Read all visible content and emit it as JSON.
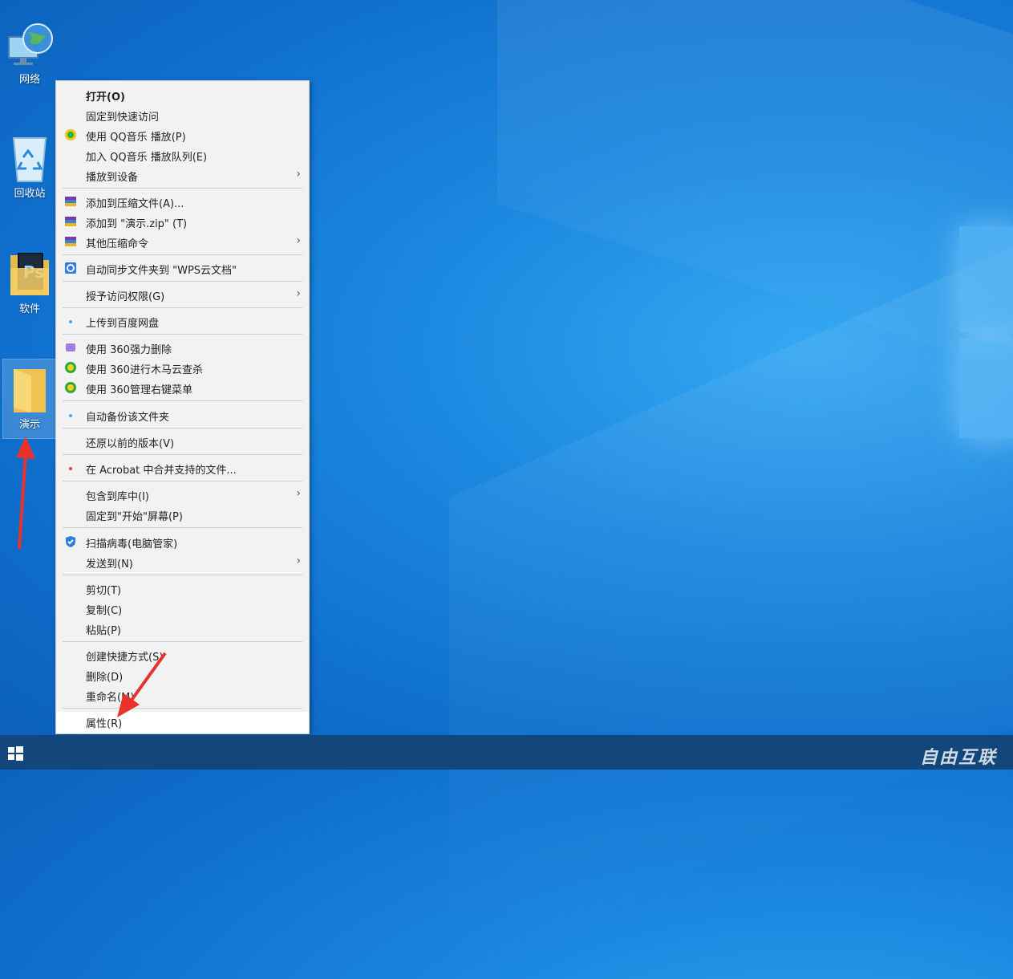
{
  "desktop": {
    "icons": [
      {
        "label": "网络",
        "icon": "network-icon"
      },
      {
        "label": "回收站",
        "icon": "recycle-bin-icon"
      },
      {
        "label": "软件",
        "icon": "folder-icon"
      },
      {
        "label": "演示",
        "icon": "folder-icon"
      }
    ]
  },
  "menu": {
    "items": [
      {
        "label": "打开(O)",
        "bold": true
      },
      {
        "label": "固定到快速访问"
      },
      {
        "label": "使用 QQ音乐 播放(P)",
        "icon": "qq-music-icon"
      },
      {
        "label": "加入 QQ音乐 播放队列(E)"
      },
      {
        "label": "播放到设备",
        "submenu": true
      },
      {
        "label": "添加到压缩文件(A)...",
        "icon": "winrar-icon"
      },
      {
        "label": "添加到 \"演示.zip\" (T)",
        "icon": "winrar-icon"
      },
      {
        "label": "其他压缩命令",
        "icon": "winrar-icon",
        "submenu": true
      },
      {
        "label": "自动同步文件夹到 \"WPS云文档\"",
        "icon": "wps-sync-icon"
      },
      {
        "label": "授予访问权限(G)",
        "submenu": true
      },
      {
        "label": "上传到百度网盘",
        "icon": "baidu-cloud-icon"
      },
      {
        "label": "使用 360强力删除",
        "icon": "shredder-360-icon"
      },
      {
        "label": "使用 360进行木马云查杀",
        "icon": "scan-360-icon"
      },
      {
        "label": "使用 360管理右键菜单",
        "icon": "manage-360-icon"
      },
      {
        "label": "自动备份该文件夹",
        "icon": "backup-icon"
      },
      {
        "label": "还原以前的版本(V)"
      },
      {
        "label": "在 Acrobat 中合并支持的文件...",
        "icon": "acrobat-icon"
      },
      {
        "label": "包含到库中(I)",
        "submenu": true
      },
      {
        "label": "固定到\"开始\"屏幕(P)"
      },
      {
        "label": "扫描病毒(电脑管家)",
        "icon": "shield-icon"
      },
      {
        "label": "发送到(N)",
        "submenu": true
      },
      {
        "label": "剪切(T)"
      },
      {
        "label": "复制(C)"
      },
      {
        "label": "粘贴(P)"
      },
      {
        "label": "创建快捷方式(S)"
      },
      {
        "label": "删除(D)"
      },
      {
        "label": "重命名(M)"
      },
      {
        "label": "属性(R)",
        "hover": true
      }
    ],
    "arrow": "›"
  },
  "taskbar": {
    "watermark": "自由互联"
  },
  "colors": {
    "annotation_arrow": "#e8322b",
    "taskbar": "#13467a"
  }
}
